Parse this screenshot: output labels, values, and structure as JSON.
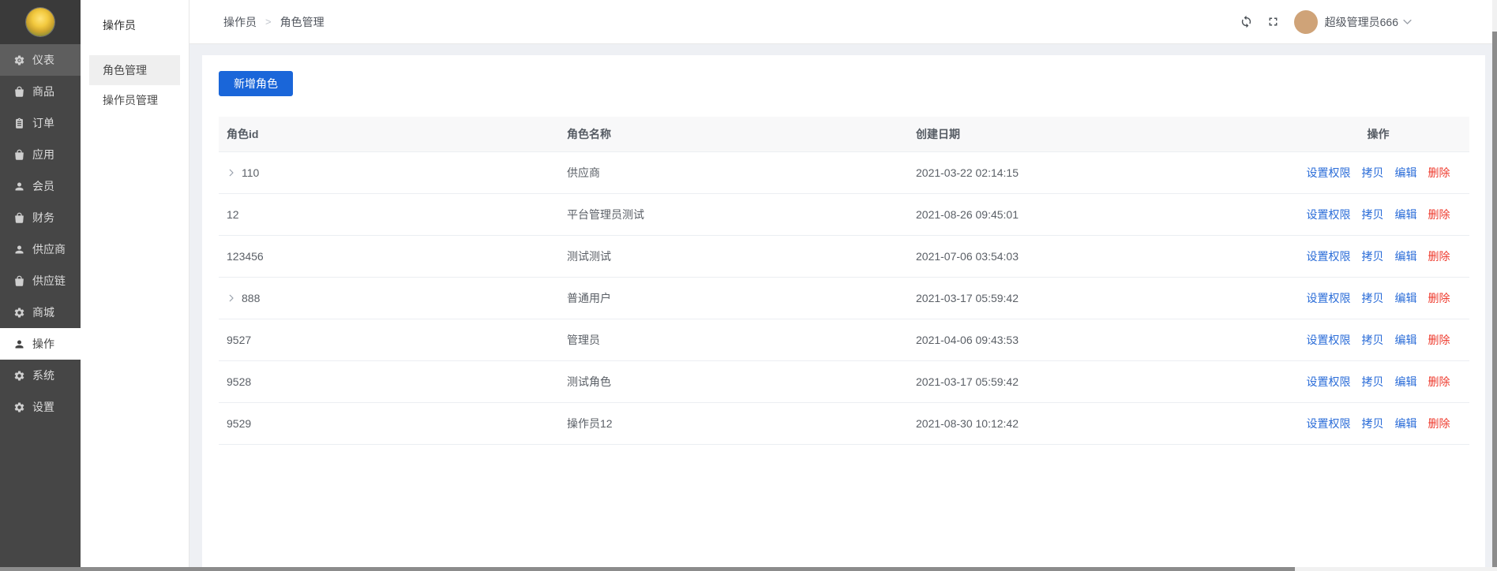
{
  "colors": {
    "primary": "#1a66d9",
    "link": "#2a6cd8",
    "danger": "#ee3b2e",
    "sidebar_bg": "#464646"
  },
  "sidebar": {
    "items": [
      {
        "label": "仪表",
        "icon": "dashboard",
        "state": "highlight"
      },
      {
        "label": "商品",
        "icon": "bag",
        "state": ""
      },
      {
        "label": "订单",
        "icon": "clipboard",
        "state": ""
      },
      {
        "label": "应用",
        "icon": "bag",
        "state": ""
      },
      {
        "label": "会员",
        "icon": "user",
        "state": ""
      },
      {
        "label": "财务",
        "icon": "bag",
        "state": ""
      },
      {
        "label": "供应商",
        "icon": "user",
        "state": ""
      },
      {
        "label": "供应链",
        "icon": "bag",
        "state": ""
      },
      {
        "label": "商城",
        "icon": "gear",
        "state": ""
      },
      {
        "label": "操作",
        "icon": "user",
        "state": "active"
      },
      {
        "label": "系统",
        "icon": "gear",
        "state": ""
      },
      {
        "label": "设置",
        "icon": "gear",
        "state": ""
      }
    ]
  },
  "submenu": {
    "title": "操作员",
    "items": [
      {
        "label": "角色管理",
        "active": true
      },
      {
        "label": "操作员管理",
        "active": false
      }
    ]
  },
  "topbar": {
    "breadcrumb": [
      "操作员",
      "角色管理"
    ],
    "separator": ">",
    "username": "超级管理员666"
  },
  "toolbar": {
    "add_button": "新增角色"
  },
  "table": {
    "columns": [
      "角色id",
      "角色名称",
      "创建日期",
      "操作"
    ],
    "actions": [
      {
        "label": "设置权限",
        "type": "link"
      },
      {
        "label": "拷贝",
        "type": "link"
      },
      {
        "label": "编辑",
        "type": "link"
      },
      {
        "label": "删除",
        "type": "danger"
      }
    ],
    "rows": [
      {
        "id": "110",
        "expandable": true,
        "name": "供应商",
        "created": "2021-03-22 02:14:15"
      },
      {
        "id": "12",
        "expandable": false,
        "name": "平台管理员测试",
        "created": "2021-08-26 09:45:01"
      },
      {
        "id": "123456",
        "expandable": false,
        "name": "测试测试",
        "created": "2021-07-06 03:54:03"
      },
      {
        "id": "888",
        "expandable": true,
        "name": "普通用户",
        "created": "2021-03-17 05:59:42"
      },
      {
        "id": "9527",
        "expandable": false,
        "name": "管理员",
        "created": "2021-04-06 09:43:53"
      },
      {
        "id": "9528",
        "expandable": false,
        "name": "测试角色",
        "created": "2021-03-17 05:59:42"
      },
      {
        "id": "9529",
        "expandable": false,
        "name": "操作员12",
        "created": "2021-08-30 10:12:42"
      }
    ]
  }
}
